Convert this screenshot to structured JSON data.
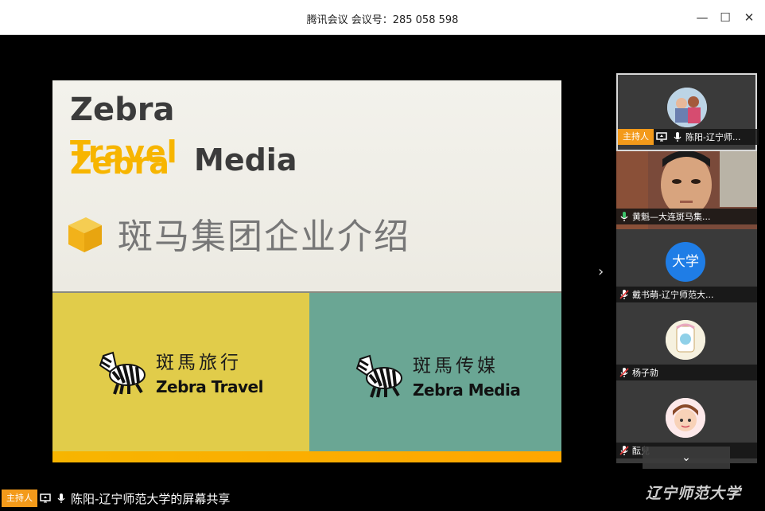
{
  "window": {
    "title": "腾讯会议 会议号：285 058 598",
    "minimize_glyph": "—",
    "maximize_glyph": "☐",
    "close_glyph": "✕"
  },
  "slide": {
    "logo_zebra": "Zebra",
    "logo_travel": "Travel",
    "logo_zebra2": "Zebra",
    "logo_media": "Media",
    "headline": "斑马集团企业介绍",
    "left_brand_zh": "斑馬旅行",
    "left_brand_en": "Zebra Travel",
    "right_brand_zh": "斑馬传媒",
    "right_brand_en": "Zebra Media",
    "accent_color": "#f7b500",
    "left_panel_color": "#e1cc4a",
    "right_panel_color": "#6aa694"
  },
  "participants": [
    {
      "name": "陈阳-辽宁师...",
      "role": "主持人",
      "mic": "on",
      "screen_share": true,
      "avatar": "photo-kids"
    },
    {
      "name": "黄魁—大连斑马集...",
      "role": "",
      "mic": "on-green",
      "screen_share": false,
      "avatar": "video"
    },
    {
      "name": "戴书萌-辽宁师范大...",
      "role": "",
      "mic": "muted",
      "screen_share": false,
      "avatar": "大学"
    },
    {
      "name": "杨子勍",
      "role": "",
      "mic": "muted",
      "screen_share": false,
      "avatar": "cartoon"
    },
    {
      "name": "酝兒",
      "role": "",
      "mic": "muted",
      "screen_share": false,
      "avatar": "cartoon-girl"
    }
  ],
  "bottom": {
    "host_badge": "主持人",
    "sharing_label": "陈阳-辽宁师范大学的屏幕共享"
  },
  "watermark": "辽宁师范大学",
  "icons": {
    "next": "chevron-right-icon",
    "collapse": "chevron-down-icon",
    "collapse_glyph": "⌄",
    "next_glyph": "›"
  }
}
